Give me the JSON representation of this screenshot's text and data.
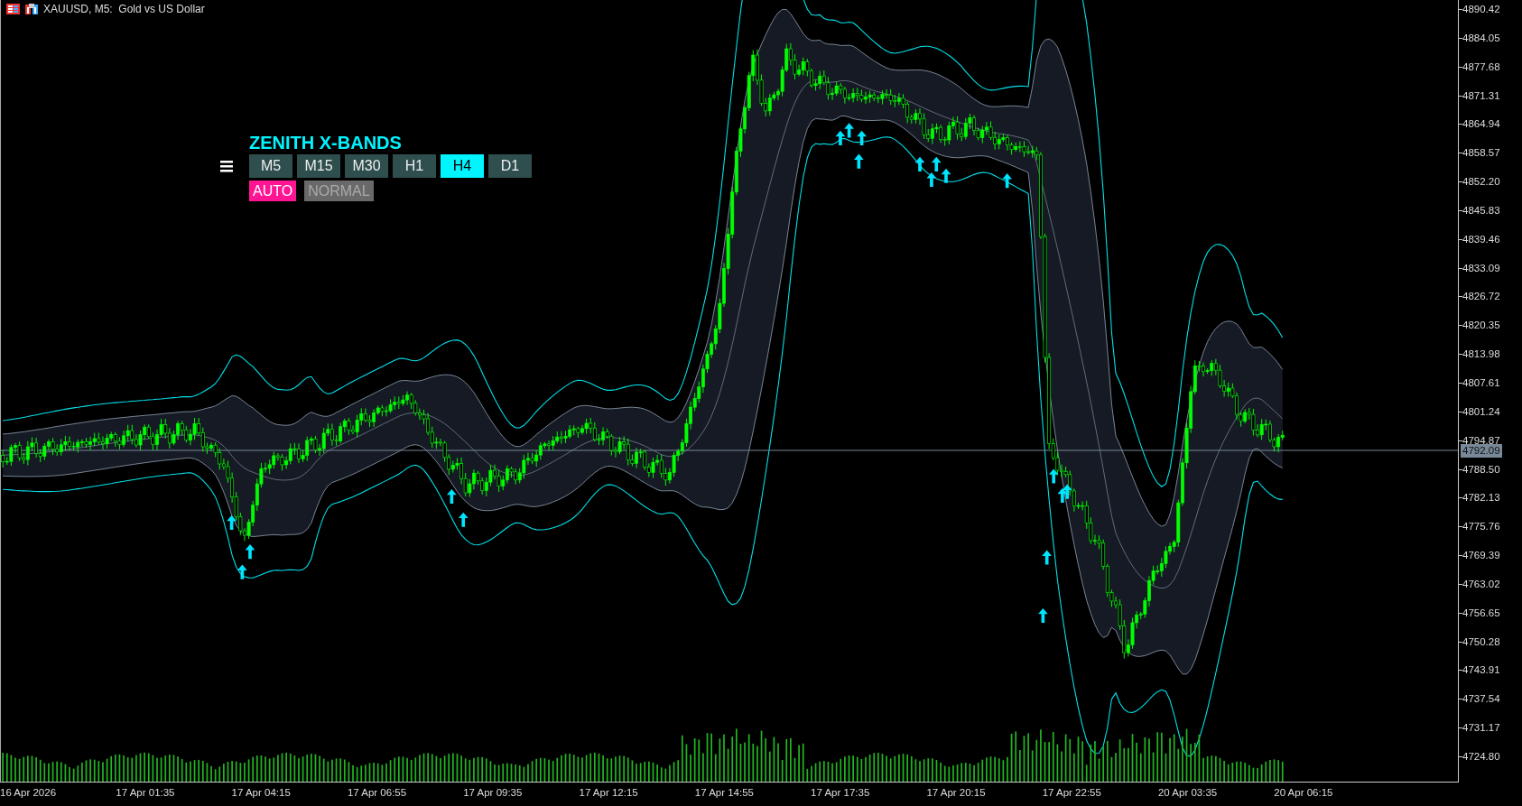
{
  "chart": {
    "title": "XAUUSD, M5:  Gold vs US Dollar"
  },
  "panel": {
    "title": "ZENITH X-BANDS",
    "timeframes": [
      {
        "label": "M5",
        "selected": false
      },
      {
        "label": "M15",
        "selected": false
      },
      {
        "label": "M30",
        "selected": false
      },
      {
        "label": "H1",
        "selected": false
      },
      {
        "label": "H4",
        "selected": true
      },
      {
        "label": "D1",
        "selected": false
      }
    ],
    "modes": [
      {
        "label": "AUTO",
        "selected": true
      },
      {
        "label": "NORMAL",
        "selected": false
      }
    ]
  },
  "price_axis": {
    "labels": [
      "4890.42",
      "4884.05",
      "4877.68",
      "4871.31",
      "4864.94",
      "4858.57",
      "4852.20",
      "4845.83",
      "4839.46",
      "4833.09",
      "4826.72",
      "4820.35",
      "4813.98",
      "4807.61",
      "4801.24",
      "4794.87",
      "4788.50",
      "4782.13",
      "4775.76",
      "4769.39",
      "4763.02",
      "4756.65",
      "4750.28",
      "4743.91",
      "4737.54",
      "4731.17",
      "4724.80"
    ],
    "current_price": "4792.09"
  },
  "time_axis": {
    "labels": [
      "16 Apr 2026",
      "17 Apr 01:35",
      "17 Apr 04:15",
      "17 Apr 06:55",
      "17 Apr 09:35",
      "17 Apr 12:15",
      "17 Apr 14:55",
      "17 Apr 17:35",
      "17 Apr 20:15",
      "17 Apr 22:55",
      "20 Apr 03:35",
      "20 Apr 06:15"
    ]
  }
}
